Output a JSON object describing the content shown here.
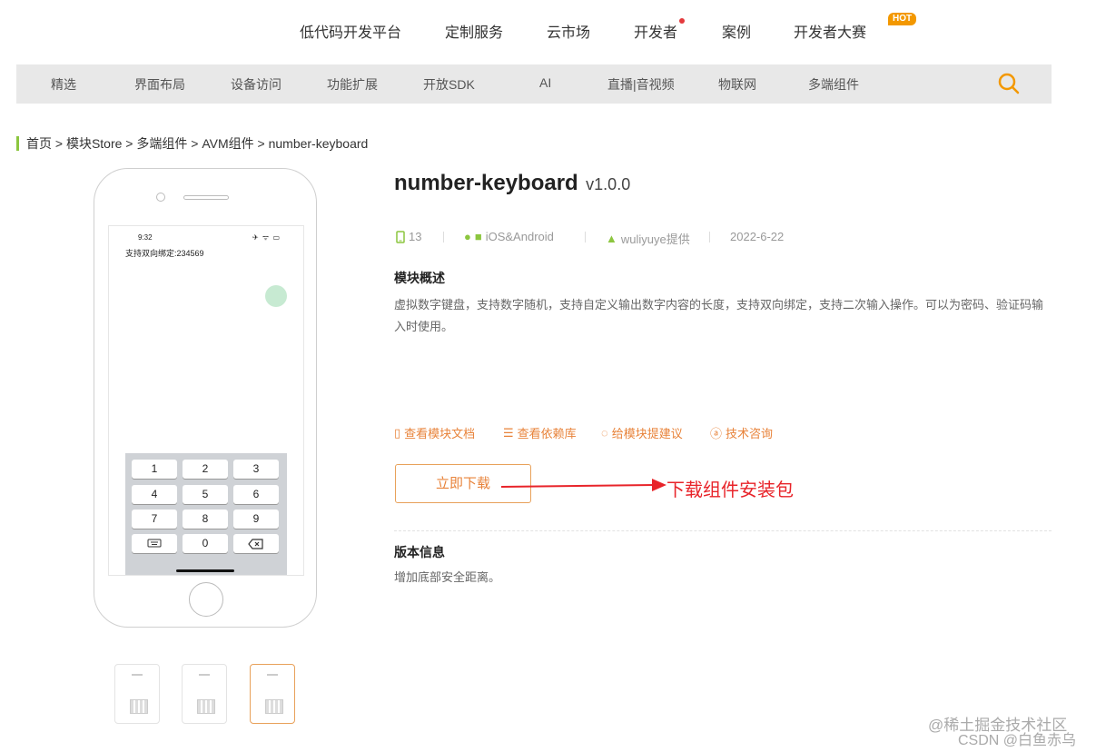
{
  "topnav": {
    "items": [
      "低代码开发平台",
      "定制服务",
      "云市场",
      "开发者",
      "案例",
      "开发者大赛"
    ],
    "hot_badge": "HOT"
  },
  "subnav": {
    "items": [
      "精选",
      "界面布局",
      "设备访问",
      "功能扩展",
      "开放SDK",
      "AI",
      "直播|音视频",
      "物联网",
      "多端组件"
    ]
  },
  "breadcrumb": "首页 > 模块Store > 多端组件 > AVM组件 > number-keyboard",
  "preview": {
    "time": "9:32",
    "status_icons": "✈ ᯤ ▭",
    "bound_text": "支持双向绑定:234569",
    "keys": [
      "1",
      "2",
      "3",
      "4",
      "5",
      "6",
      "7",
      "8",
      "9",
      "",
      "0",
      ""
    ]
  },
  "module": {
    "name": "number-keyboard",
    "version": "v1.0.0",
    "downloads": "13",
    "platform": "iOS&Android",
    "provider": "wuliyuye提供",
    "date": "2022-6-22"
  },
  "overview": {
    "title": "模块概述",
    "text": "虚拟数字键盘，支持数字随机，支持自定义输出数字内容的长度，支持双向绑定，支持二次输入操作。可以为密码、验证码输入时使用。"
  },
  "links": [
    "查看模块文档",
    "查看依赖库",
    "给模块提建议",
    "技术咨询"
  ],
  "download_label": "立即下载",
  "annotation": "下载组件安装包",
  "version_info": {
    "title": "版本信息",
    "text": "增加底部安全距离。"
  },
  "watermark": {
    "line1": "@稀土掘金技术社区",
    "line2": "CSDN @白鱼赤乌"
  },
  "colors": {
    "accent": "#e8833a",
    "green": "#8cc63f",
    "annotation_red": "#e8242a"
  }
}
